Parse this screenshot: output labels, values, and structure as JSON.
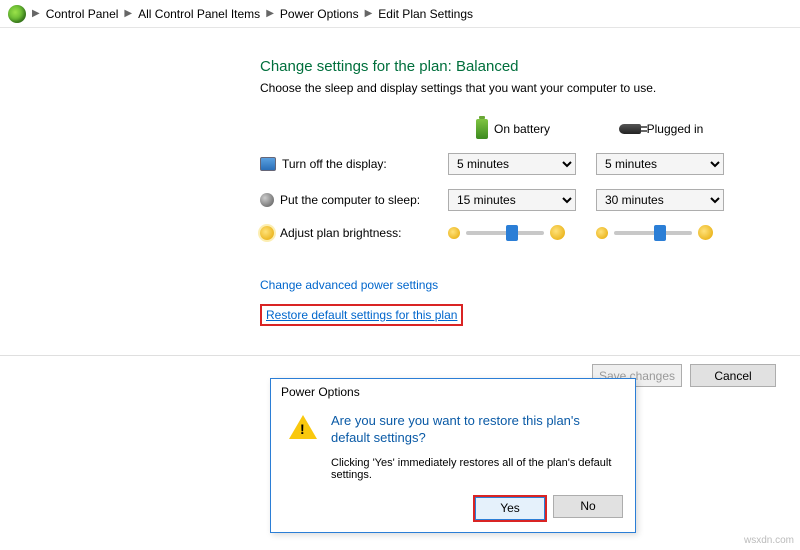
{
  "breadcrumb": {
    "items": [
      "Control Panel",
      "All Control Panel Items",
      "Power Options",
      "Edit Plan Settings"
    ]
  },
  "page": {
    "heading": "Change settings for the plan: Balanced",
    "subtitle": "Choose the sleep and display settings that you want your computer to use."
  },
  "columns": {
    "battery": "On battery",
    "plugged": "Plugged in"
  },
  "rows": {
    "display_label": "Turn off the display:",
    "sleep_label": "Put the computer to sleep:",
    "brightness_label": "Adjust plan brightness:"
  },
  "values": {
    "display_battery": "5 minutes",
    "display_plugged": "5 minutes",
    "sleep_battery": "15 minutes",
    "sleep_plugged": "30 minutes",
    "brightness_battery_pct": 55,
    "brightness_plugged_pct": 55
  },
  "links": {
    "advanced": "Change advanced power settings",
    "restore": "Restore default settings for this plan"
  },
  "footer": {
    "save": "Save changes",
    "cancel": "Cancel"
  },
  "dialog": {
    "title": "Power Options",
    "question": "Are you sure you want to restore this plan's default settings?",
    "explain": "Clicking 'Yes' immediately restores all of the plan's default settings.",
    "yes": "Yes",
    "no": "No"
  },
  "watermark": "wsxdn.com"
}
